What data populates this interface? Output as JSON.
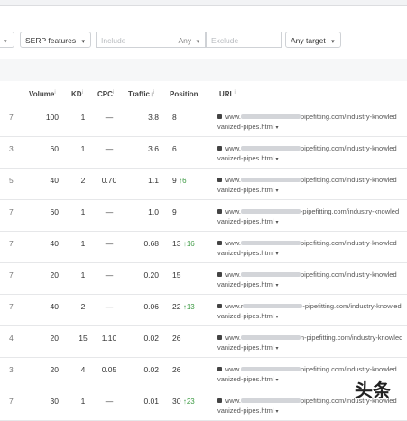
{
  "filters": {
    "first_chevron": "▾",
    "serp_features": "SERP features",
    "include_placeholder": "Include",
    "include_any": "Any",
    "exclude_placeholder": "Exclude",
    "any_target": "Any target",
    "chevron": "▾"
  },
  "columns": {
    "volume": "Volume",
    "kd": "KD",
    "cpc": "CPC",
    "traffic": "Traffic",
    "traffic_sort": "↓",
    "position": "Position",
    "url": "URL",
    "info": "i"
  },
  "url": {
    "prefix": "www.",
    "suffix": "pipefitting.com/industry-knowled",
    "line2": "vanized-pipes.html"
  },
  "rows": [
    {
      "kc": "7",
      "volume": "100",
      "kd": "1",
      "cpc": "—",
      "traffic": "3.8",
      "position": "8",
      "change": "",
      "prefix": "www.",
      "suffix": "pipefitting.com/industry-knowled"
    },
    {
      "kc": "3",
      "volume": "60",
      "kd": "1",
      "cpc": "—",
      "traffic": "3.6",
      "position": "6",
      "change": "",
      "prefix": "www.",
      "suffix": "pipefitting.com/industry-knowled"
    },
    {
      "kc": "5",
      "volume": "40",
      "kd": "2",
      "cpc": "0.70",
      "traffic": "1.1",
      "position": "9",
      "change": "↑6",
      "prefix": "www.",
      "suffix": "pipefitting.com/industry-knowled"
    },
    {
      "kc": "7",
      "volume": "60",
      "kd": "1",
      "cpc": "—",
      "traffic": "1.0",
      "position": "9",
      "change": "",
      "prefix": "www.",
      "suffix": "-pipefitting.com/industry-knowled"
    },
    {
      "kc": "7",
      "volume": "40",
      "kd": "1",
      "cpc": "—",
      "traffic": "0.68",
      "position": "13",
      "change": "↑16",
      "prefix": "www.",
      "suffix": "pipefitting.com/industry-knowled"
    },
    {
      "kc": "7",
      "volume": "20",
      "kd": "1",
      "cpc": "—",
      "traffic": "0.20",
      "position": "15",
      "change": "",
      "prefix": "www.",
      "suffix": "pipefitting.com/industry-knowled"
    },
    {
      "kc": "7",
      "volume": "40",
      "kd": "2",
      "cpc": "—",
      "traffic": "0.06",
      "position": "22",
      "change": "↑13",
      "prefix": "www.r",
      "suffix": "-pipefitting.com/industry-knowled"
    },
    {
      "kc": "4",
      "volume": "20",
      "kd": "15",
      "cpc": "1.10",
      "traffic": "0.02",
      "position": "26",
      "change": "",
      "prefix": "www.",
      "suffix": "n-pipefitting.com/industry-knowled"
    },
    {
      "kc": "3",
      "volume": "20",
      "kd": "4",
      "cpc": "0.05",
      "traffic": "0.02",
      "position": "26",
      "change": "",
      "prefix": "www.",
      "suffix": "pipefitting.com/industry-knowled"
    },
    {
      "kc": "7",
      "volume": "30",
      "kd": "1",
      "cpc": "—",
      "traffic": "0.01",
      "position": "30",
      "change": "↑23",
      "prefix": "www.",
      "suffix": "pipefitting.com/industry-knowled"
    }
  ],
  "watermark": "头条"
}
